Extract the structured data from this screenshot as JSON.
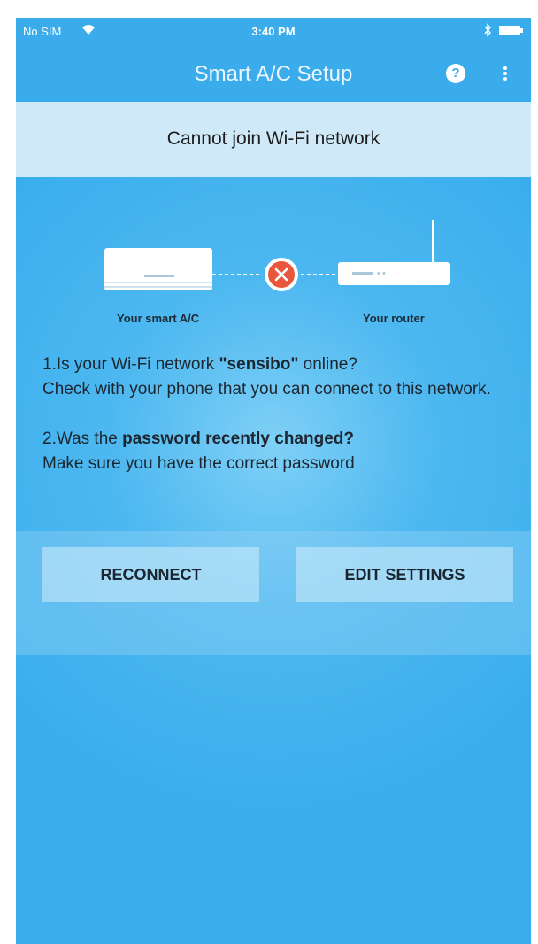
{
  "status_bar": {
    "carrier": "No SIM",
    "time": "3:40 PM"
  },
  "app_bar": {
    "title": "Smart A/C Setup",
    "help_label": "?"
  },
  "notice": {
    "text": "Cannot join Wi-Fi network"
  },
  "diagram": {
    "ac_label": "Your smart A/C",
    "router_label": "Your router",
    "connection_status": "failed",
    "error_color": "#e8573c"
  },
  "instructions": {
    "q1_prefix": "1.Is your Wi-Fi network ",
    "q1_network": "\"sensibo\"",
    "q1_suffix": " online?",
    "q1_detail": "Check with your phone that you can connect to this network.",
    "q2_prefix": "2.Was the ",
    "q2_strong": "password recently changed?",
    "q2_detail": "Make sure you have the correct password"
  },
  "actions": {
    "reconnect_label": "RECONNECT",
    "edit_settings_label": "EDIT SETTINGS"
  },
  "colors": {
    "primary": "#3aabeb",
    "banner": "#cfe9f8"
  }
}
